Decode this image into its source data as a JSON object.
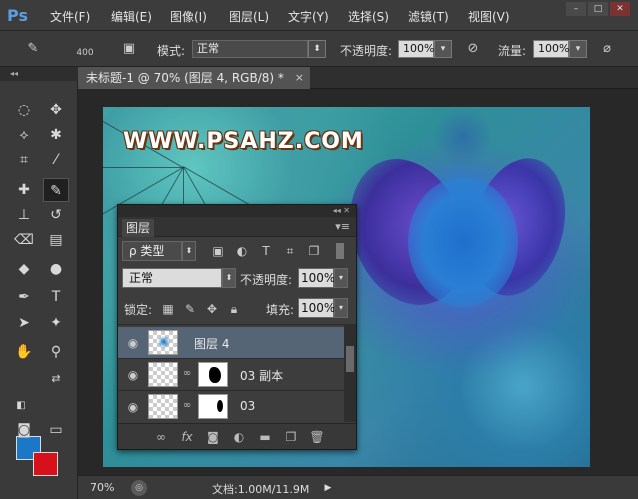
{
  "app": {
    "logo": "Ps",
    "menu": [
      "文件(F)",
      "编辑(E)",
      "图像(I)",
      "图层(L)",
      "文字(Y)",
      "选择(S)",
      "滤镜(T)",
      "视图(V)"
    ],
    "window_controls": [
      "–",
      "□",
      "✕"
    ]
  },
  "options": {
    "brush_size": "400",
    "mode_label": "模式:",
    "mode_value": "正常",
    "opacity_label": "不透明度:",
    "opacity_value": "100%",
    "flow_label": "流量:",
    "flow_value": "100%"
  },
  "document": {
    "tab_title": "未标题-1 @ 70% (图层 4, RGB/8) *",
    "tab_close": "×",
    "watermark": "WWW.PSAHZ.COM"
  },
  "status": {
    "zoom": "70%",
    "doc_info": "文档:1.00M/11.9M"
  },
  "layers_panel": {
    "tab": "图层",
    "filter_label": "ρ 类型",
    "blend_mode": "正常",
    "opacity_label": "不透明度:",
    "opacity_value": "100%",
    "lock_label": "锁定:",
    "fill_label": "填充:",
    "fill_value": "100%",
    "layers": [
      {
        "name": "图层 4",
        "selected": true
      },
      {
        "name": "03 副本",
        "selected": false
      },
      {
        "name": "03",
        "selected": false
      }
    ],
    "footer_fx": "fx"
  },
  "colors": {
    "foreground": "#1a78c6",
    "background": "#d8101c",
    "selected_layer": "#566575"
  }
}
